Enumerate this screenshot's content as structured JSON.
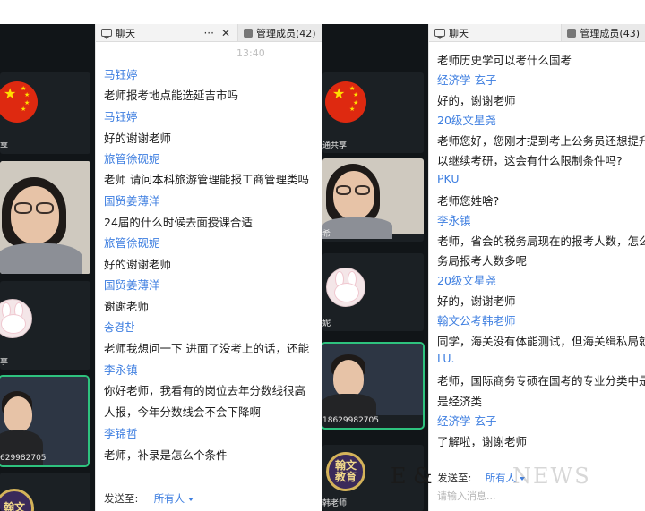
{
  "left": {
    "tiles": [
      {
        "name": "享"
      },
      {
        "name": ""
      },
      {
        "name": "享"
      },
      {
        "name": "629982705"
      },
      {
        "name": ""
      }
    ],
    "chat": {
      "tab_chat": "聊天",
      "tab_members": "管理成员(42)",
      "more_icon": "···",
      "close_icon": "✕",
      "time": "13:40",
      "messages": [
        {
          "sender": "马钰婷",
          "text": "老师报考地点能选延吉市吗"
        },
        {
          "sender": "马钰婷",
          "text": "好的谢谢老师"
        },
        {
          "sender": "旅管徐砚妮",
          "text": "老师 请问本科旅游管理能报工商管理类吗"
        },
        {
          "sender": "国贸姜薄洋",
          "text": "24届的什么时候去面授课合适"
        },
        {
          "sender": "旅管徐砚妮",
          "text": "好的谢谢老师"
        },
        {
          "sender": "国贸姜薄洋",
          "text": "谢谢老师"
        },
        {
          "sender": "송경찬",
          "text": "老师我想问一下 进面了没考上的话，还能"
        },
        {
          "sender": "李永镇",
          "text": "你好老师，我看有的岗位去年分数线很高"
        },
        {
          "sender": "",
          "text": "人报，今年分数线会不会下降啊"
        },
        {
          "sender": "李锦哲",
          "text": "老师，补录是怎么个条件"
        }
      ],
      "send_to_label": "发送至:",
      "send_to_value": "所有人"
    }
  },
  "right": {
    "tiles": [
      {
        "name": "通共享"
      },
      {
        "name": "希"
      },
      {
        "name": "妮"
      },
      {
        "name": "18629982705"
      },
      {
        "name": "韩老师"
      }
    ],
    "chat": {
      "tab_chat": "聊天",
      "tab_members": "管理成员(43)",
      "messages": [
        {
          "sender": "",
          "text": "老师历史学可以考什么国考"
        },
        {
          "sender": "经济学 玄子",
          "text": "好的，谢谢老师"
        },
        {
          "sender": "20级文星尧",
          "text": "老师您好，您刚才提到考上公务员还想提升"
        },
        {
          "sender": "",
          "text": "以继续考研，这会有什么限制条件吗?"
        },
        {
          "sender": "PKU",
          "text": "老师您姓啥?"
        },
        {
          "sender": "李永镇",
          "text": "老师，省会的税务局现在的报考人数，怎么"
        },
        {
          "sender": "",
          "text": "务局报考人数多呢"
        },
        {
          "sender": "20级文星尧",
          "text": "好的，谢谢老师"
        },
        {
          "sender": "翰文公考韩老师",
          "text": "同学，海关没有体能测试，但海关缉私局就"
        },
        {
          "sender": "LU.",
          "text": "老师，国际商务专硕在国考的专业分类中是"
        },
        {
          "sender": "",
          "text": "是经济类"
        },
        {
          "sender": "经济学 玄子",
          "text": "了解啦，谢谢老师"
        }
      ],
      "send_to_label": "发送至:",
      "send_to_value": "所有人",
      "input_placeholder": "请输入消息..."
    }
  },
  "watermark": {
    "text": "E &",
    "faint": "NEWS"
  },
  "crest_text": [
    "翰文",
    "教育"
  ],
  "colors": {
    "sender": "#3d7ee0",
    "text": "#1c1c1c",
    "video_bg": "#111518",
    "active_border": "#2ec27e"
  }
}
